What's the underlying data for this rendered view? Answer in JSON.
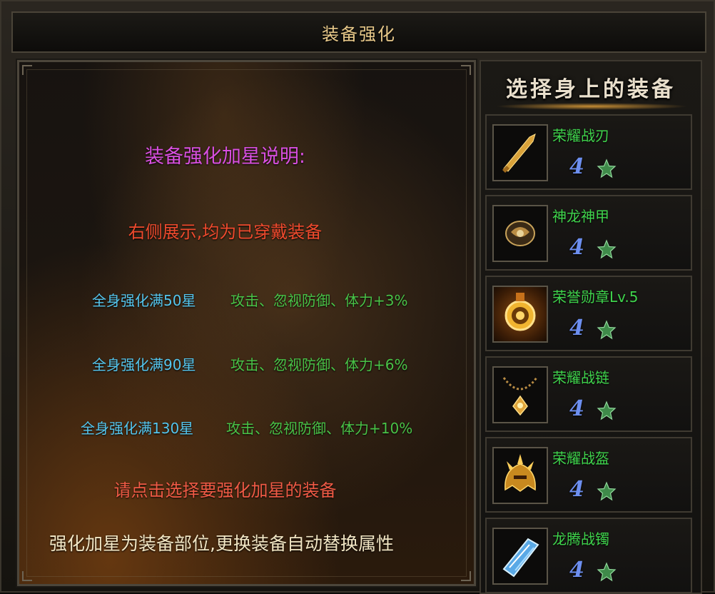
{
  "window": {
    "title": "装备强化"
  },
  "info_panel": {
    "heading": "装备强化加星说明:",
    "subtitle": "右侧展示,均为已穿戴装备",
    "bonus_rows": [
      {
        "requirement": "全身强化满50星",
        "effect": "攻击、忽视防御、体力+3%"
      },
      {
        "requirement": "全身强化满90星",
        "effect": "攻击、忽视防御、体力+6%"
      },
      {
        "requirement": "全身强化满130星",
        "effect": "攻击、忽视防御、体力+10%"
      }
    ],
    "prompt": "请点击选择要强化加星的装备",
    "note": "强化加星为装备部位,更换装备自动替换属性"
  },
  "equipment_panel": {
    "title": "选择身上的装备",
    "items": [
      {
        "name": "荣耀战刃",
        "stars": "4",
        "icon": "sword-icon"
      },
      {
        "name": "神龙神甲",
        "stars": "4",
        "icon": "armor-icon"
      },
      {
        "name": "荣誉勋章Lv.5",
        "stars": "4",
        "icon": "medal-icon"
      },
      {
        "name": "荣耀战链",
        "stars": "4",
        "icon": "necklace-icon"
      },
      {
        "name": "荣耀战盔",
        "stars": "4",
        "icon": "helmet-icon"
      },
      {
        "name": "龙腾战镯",
        "stars": "4",
        "icon": "bracelet-icon"
      }
    ]
  },
  "colors": {
    "heading": "#d84fe0",
    "subtitle": "#ef4a2d",
    "requirement": "#55c6ee",
    "effect": "#49c247",
    "item_name": "#3fd34c",
    "star_count": "#6d8ff0"
  }
}
